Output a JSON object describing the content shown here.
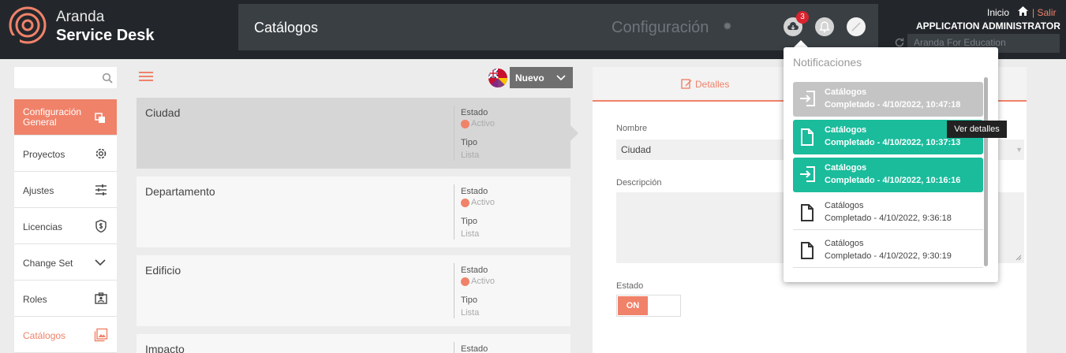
{
  "header": {
    "logo_line1": "Aranda",
    "logo_line2": "Service Desk",
    "page_title": "Catálogos",
    "config_label": "Configuración",
    "notification_count": "3",
    "home_label": "Inicio",
    "separator": "|",
    "logout_label": "Salir",
    "user_name": "APPLICATION ADMINISTRATOR",
    "project_name": "Aranda For Education"
  },
  "sidebar": {
    "items": [
      {
        "label": "Configuración General",
        "icon": "copy-icon"
      },
      {
        "label": "Proyectos",
        "icon": "gear-icon"
      },
      {
        "label": "Ajustes",
        "icon": "sliders-icon"
      },
      {
        "label": "Licencias",
        "icon": "shield-dollar-icon"
      },
      {
        "label": "Change Set",
        "icon": "chevron-down-icon"
      },
      {
        "label": "Roles",
        "icon": "id-badge-icon"
      },
      {
        "label": "Catálogos",
        "icon": "images-icon"
      }
    ]
  },
  "toolbar": {
    "new_button_label": "Nuevo"
  },
  "catalog_list": {
    "items": [
      {
        "name": "Ciudad",
        "state_label": "Estado",
        "state_value": "Activo",
        "type_label": "Tipo",
        "type_value": "Lista"
      },
      {
        "name": "Departamento",
        "state_label": "Estado",
        "state_value": "Activo",
        "type_label": "Tipo",
        "type_value": "Lista"
      },
      {
        "name": "Edificio",
        "state_label": "Estado",
        "state_value": "Activo",
        "type_label": "Tipo",
        "type_value": "Lista"
      },
      {
        "name": "Impacto",
        "state_label": "Estado",
        "state_value": "",
        "type_label": "",
        "type_value": ""
      }
    ]
  },
  "details": {
    "tab_label": "Detalles",
    "name_label": "Nombre",
    "name_value": "Ciudad",
    "description_label": "Descripción",
    "state_label": "Estado",
    "toggle_on_label": "ON"
  },
  "notifications": {
    "title": "Notificaciones",
    "tooltip": "Ver detalles",
    "items": [
      {
        "title": "Catálogos",
        "status": "Completado - 4/10/2022, 10:47:18",
        "icon": "import-icon"
      },
      {
        "title": "Catálogos",
        "status": "Completado - 4/10/2022, 10:37:13",
        "icon": "file-icon"
      },
      {
        "title": "Catálogos",
        "status": "Completado - 4/10/2022, 10:16:16",
        "icon": "import-icon"
      },
      {
        "title": "Catálogos",
        "status": "Completado - 4/10/2022, 9:36:18",
        "icon": "file-icon"
      },
      {
        "title": "Catálogos",
        "status": "Completado - 4/10/2022, 9:30:19",
        "icon": "file-icon"
      }
    ]
  },
  "colors": {
    "accent": "#f0826a",
    "header_bg": "#23272b",
    "notification_green": "#1abc9c",
    "badge_red": "#d9232e"
  }
}
